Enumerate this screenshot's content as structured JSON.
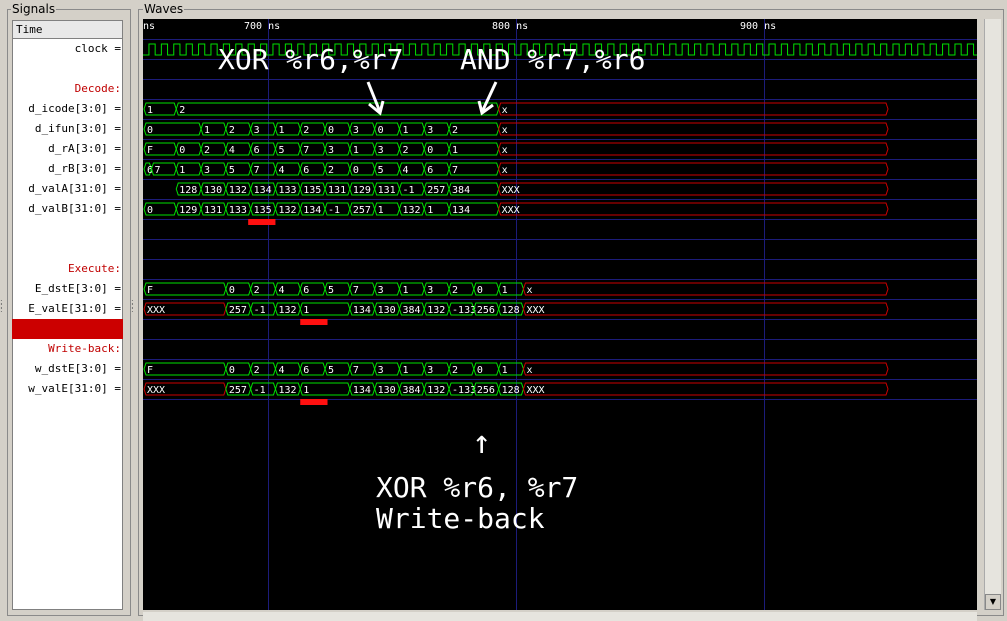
{
  "panels": {
    "signals_title": "Signals",
    "waves_title": "Waves"
  },
  "header_label": "Time",
  "signals": [
    {
      "label": "clock",
      "group": false
    },
    {
      "label": "",
      "group": false
    },
    {
      "label": "Decode:",
      "group": true
    },
    {
      "label": "d_icode[3:0]",
      "group": false
    },
    {
      "label": "d_ifun[3:0]",
      "group": false
    },
    {
      "label": "d_rA[3:0]",
      "group": false
    },
    {
      "label": "d_rB[3:0]",
      "group": false
    },
    {
      "label": "d_valA[31:0]",
      "group": false
    },
    {
      "label": "d_valB[31:0]",
      "group": false
    },
    {
      "label": "",
      "group": false
    },
    {
      "label": "",
      "group": false
    },
    {
      "label": "Execute:",
      "group": true
    },
    {
      "label": "E_dstE[3:0]",
      "group": false
    },
    {
      "label": "E_valE[31:0]",
      "group": false
    },
    {
      "label": "",
      "group": false,
      "selected": true
    },
    {
      "label": "Write-back:",
      "group": true
    },
    {
      "label": "w_dstE[3:0]",
      "group": false
    },
    {
      "label": "w_valE[31:0]",
      "group": false
    }
  ],
  "time_ruler": [
    {
      "label": "ns",
      "t": 650
    },
    {
      "label": "700 ns",
      "t": 700
    },
    {
      "label": "800 ns",
      "t": 800
    },
    {
      "label": "900 ns",
      "t": 900
    }
  ],
  "buses": {
    "d_icode": [
      [
        "1",
        650,
        663,
        "ok"
      ],
      [
        "2",
        663,
        793,
        "ok"
      ],
      [
        "x",
        793,
        950,
        "x"
      ]
    ],
    "d_ifun": [
      [
        "0",
        650,
        673,
        "ok"
      ],
      [
        "1",
        673,
        683,
        "ok"
      ],
      [
        "2",
        683,
        693,
        "ok"
      ],
      [
        "3",
        693,
        703,
        "ok"
      ],
      [
        "1",
        703,
        713,
        "ok"
      ],
      [
        "2",
        713,
        723,
        "ok"
      ],
      [
        "0",
        723,
        733,
        "ok"
      ],
      [
        "3",
        733,
        743,
        "ok"
      ],
      [
        "0",
        743,
        753,
        "ok"
      ],
      [
        "1",
        753,
        763,
        "ok"
      ],
      [
        "3",
        763,
        773,
        "ok"
      ],
      [
        "2",
        773,
        793,
        "ok"
      ],
      [
        "x",
        793,
        950,
        "x"
      ]
    ],
    "d_rA": [
      [
        "F",
        650,
        663,
        "ok"
      ],
      [
        "0",
        663,
        673,
        "ok"
      ],
      [
        "2",
        673,
        683,
        "ok"
      ],
      [
        "4",
        683,
        693,
        "ok"
      ],
      [
        "6",
        693,
        703,
        "ok"
      ],
      [
        "5",
        703,
        713,
        "ok"
      ],
      [
        "7",
        713,
        723,
        "ok"
      ],
      [
        "3",
        723,
        733,
        "ok"
      ],
      [
        "1",
        733,
        743,
        "ok"
      ],
      [
        "3",
        743,
        753,
        "ok"
      ],
      [
        "2",
        753,
        763,
        "ok"
      ],
      [
        "0",
        763,
        773,
        "ok"
      ],
      [
        "1",
        773,
        793,
        "ok"
      ],
      [
        "x",
        793,
        950,
        "x"
      ]
    ],
    "d_rB": [
      [
        "6",
        650,
        653,
        "ok"
      ],
      [
        "7",
        653,
        663,
        "ok"
      ],
      [
        "1",
        663,
        673,
        "ok"
      ],
      [
        "3",
        673,
        683,
        "ok"
      ],
      [
        "5",
        683,
        693,
        "ok"
      ],
      [
        "7",
        693,
        703,
        "ok"
      ],
      [
        "4",
        703,
        713,
        "ok"
      ],
      [
        "6",
        713,
        723,
        "ok"
      ],
      [
        "2",
        723,
        733,
        "ok"
      ],
      [
        "0",
        733,
        743,
        "ok"
      ],
      [
        "5",
        743,
        753,
        "ok"
      ],
      [
        "4",
        753,
        763,
        "ok"
      ],
      [
        "6",
        763,
        773,
        "ok"
      ],
      [
        "7",
        773,
        793,
        "ok"
      ],
      [
        "x",
        793,
        950,
        "x"
      ]
    ],
    "d_valA": [
      [
        "128",
        663,
        673,
        "ok"
      ],
      [
        "130",
        673,
        683,
        "ok"
      ],
      [
        "132",
        683,
        693,
        "ok"
      ],
      [
        "134",
        693,
        703,
        "ok"
      ],
      [
        "133",
        703,
        713,
        "ok"
      ],
      [
        "135",
        713,
        723,
        "ok"
      ],
      [
        "131",
        723,
        733,
        "ok"
      ],
      [
        "129",
        733,
        743,
        "ok"
      ],
      [
        "131",
        743,
        753,
        "ok"
      ],
      [
        "-1",
        753,
        763,
        "ok"
      ],
      [
        "257",
        763,
        773,
        "ok"
      ],
      [
        "384",
        773,
        793,
        "ok"
      ],
      [
        "XXX",
        793,
        950,
        "x"
      ]
    ],
    "d_valB": [
      [
        "0",
        650,
        663,
        "ok"
      ],
      [
        "129",
        663,
        673,
        "ok"
      ],
      [
        "131",
        673,
        683,
        "ok"
      ],
      [
        "133",
        683,
        693,
        "ok"
      ],
      [
        "135",
        693,
        703,
        "ok"
      ],
      [
        "132",
        703,
        713,
        "ok"
      ],
      [
        "134",
        713,
        723,
        "ok"
      ],
      [
        "-1",
        723,
        733,
        "ok"
      ],
      [
        "257",
        733,
        743,
        "ok"
      ],
      [
        "1",
        743,
        753,
        "ok"
      ],
      [
        "132",
        753,
        763,
        "ok"
      ],
      [
        "1",
        763,
        773,
        "ok"
      ],
      [
        "134",
        773,
        793,
        "ok"
      ],
      [
        "XXX",
        793,
        950,
        "x"
      ]
    ],
    "E_dstE": [
      [
        "F",
        650,
        683,
        "ok"
      ],
      [
        "0",
        683,
        693,
        "ok"
      ],
      [
        "2",
        693,
        703,
        "ok"
      ],
      [
        "4",
        703,
        713,
        "ok"
      ],
      [
        "6",
        713,
        723,
        "ok"
      ],
      [
        "5",
        723,
        733,
        "ok"
      ],
      [
        "7",
        733,
        743,
        "ok"
      ],
      [
        "3",
        743,
        753,
        "ok"
      ],
      [
        "1",
        753,
        763,
        "ok"
      ],
      [
        "3",
        763,
        773,
        "ok"
      ],
      [
        "2",
        773,
        783,
        "ok"
      ],
      [
        "0",
        783,
        793,
        "ok"
      ],
      [
        "1",
        793,
        803,
        "ok"
      ],
      [
        "x",
        803,
        950,
        "x"
      ]
    ],
    "E_valE": [
      [
        "XXX",
        650,
        683,
        "x"
      ],
      [
        "257",
        683,
        693,
        "ok"
      ],
      [
        "-1",
        693,
        703,
        "ok"
      ],
      [
        "132",
        703,
        713,
        "ok"
      ],
      [
        "1",
        713,
        733,
        "ok"
      ],
      [
        "134",
        733,
        743,
        "ok"
      ],
      [
        "130",
        743,
        753,
        "ok"
      ],
      [
        "384",
        753,
        763,
        "ok"
      ],
      [
        "132",
        763,
        773,
        "ok"
      ],
      [
        "-133",
        773,
        783,
        "ok"
      ],
      [
        "256",
        783,
        793,
        "ok"
      ],
      [
        "128",
        793,
        803,
        "ok"
      ],
      [
        "XXX",
        803,
        950,
        "x"
      ]
    ],
    "w_dstE": [
      [
        "F",
        650,
        683,
        "ok"
      ],
      [
        "0",
        683,
        693,
        "ok"
      ],
      [
        "2",
        693,
        703,
        "ok"
      ],
      [
        "4",
        703,
        713,
        "ok"
      ],
      [
        "6",
        713,
        723,
        "ok"
      ],
      [
        "5",
        723,
        733,
        "ok"
      ],
      [
        "7",
        733,
        743,
        "ok"
      ],
      [
        "3",
        743,
        753,
        "ok"
      ],
      [
        "1",
        753,
        763,
        "ok"
      ],
      [
        "3",
        763,
        773,
        "ok"
      ],
      [
        "2",
        773,
        783,
        "ok"
      ],
      [
        "0",
        783,
        793,
        "ok"
      ],
      [
        "1",
        793,
        803,
        "ok"
      ],
      [
        "x",
        803,
        950,
        "x"
      ]
    ],
    "w_valE": [
      [
        "XXX",
        650,
        683,
        "x"
      ],
      [
        "257",
        683,
        693,
        "ok"
      ],
      [
        "-1",
        693,
        703,
        "ok"
      ],
      [
        "132",
        703,
        713,
        "ok"
      ],
      [
        "1",
        713,
        733,
        "ok"
      ],
      [
        "134",
        733,
        743,
        "ok"
      ],
      [
        "130",
        743,
        753,
        "ok"
      ],
      [
        "384",
        753,
        763,
        "ok"
      ],
      [
        "132",
        763,
        773,
        "ok"
      ],
      [
        "-133",
        773,
        783,
        "ok"
      ],
      [
        "256",
        783,
        793,
        "ok"
      ],
      [
        "128",
        793,
        803,
        "ok"
      ],
      [
        "XXX",
        803,
        950,
        "x"
      ]
    ]
  },
  "clock_period_ns": 5,
  "highlights": [
    {
      "row": "d_valB",
      "t0": 692,
      "t1": 703
    },
    {
      "row": "E_valE",
      "t0": 713,
      "t1": 724
    },
    {
      "row": "w_valE",
      "t0": 713,
      "t1": 724
    }
  ],
  "annotations": {
    "xor_label": "XOR %r6,%r7",
    "and_label": "AND %r7,%r6",
    "wb_line1": "XOR %r6, %r7",
    "wb_line2": "Write-back",
    "up_arrow": "↑"
  },
  "colors": {
    "wave": "#00e000",
    "xwave": "#cc0000",
    "grid": "#1c1c7a",
    "highlight": "#ff1010",
    "group_text": "#c00000"
  }
}
